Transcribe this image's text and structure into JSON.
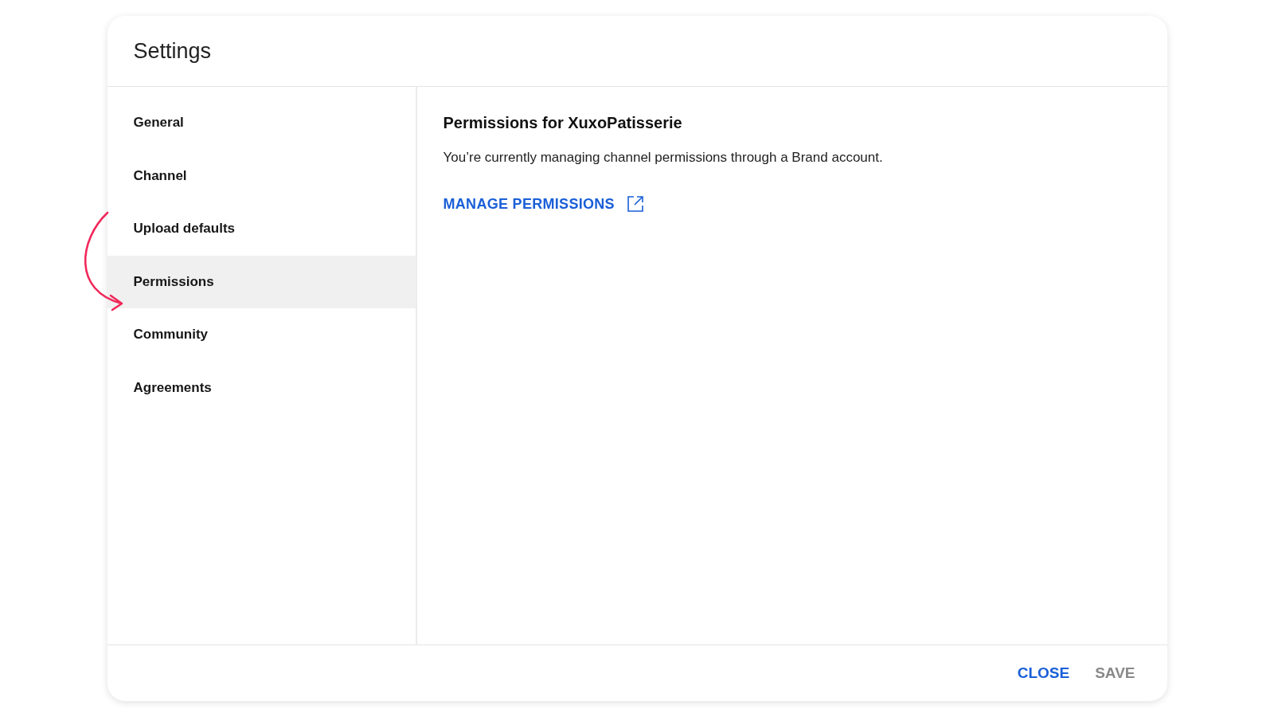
{
  "window": {
    "title": "Settings"
  },
  "sidebar": {
    "items": [
      {
        "label": "General",
        "selected": false
      },
      {
        "label": "Channel",
        "selected": false
      },
      {
        "label": "Upload defaults",
        "selected": false
      },
      {
        "label": "Permissions",
        "selected": true
      },
      {
        "label": "Community",
        "selected": false
      },
      {
        "label": "Agreements",
        "selected": false
      }
    ]
  },
  "content": {
    "heading": "Permissions for XuxoPatisserie",
    "description": "You’re currently managing channel permissions through a Brand account.",
    "link": "MANAGE PERMISSIONS"
  },
  "buttons": [
    {
      "label": "CLOSE",
      "disabled": false
    },
    {
      "label": "SAVE",
      "disabled": true
    }
  ]
}
